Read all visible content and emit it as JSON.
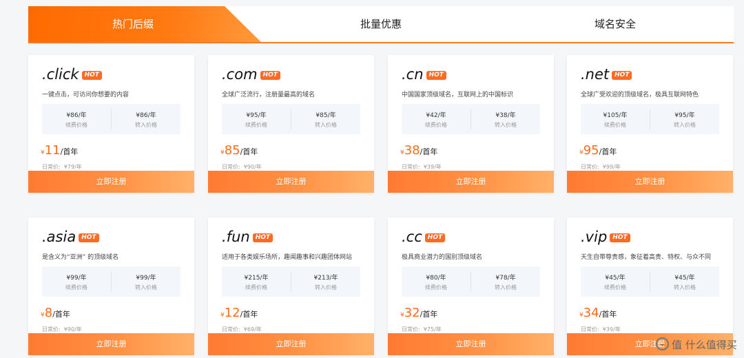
{
  "tabs": [
    {
      "label": "热门后缀",
      "active": true
    },
    {
      "label": "批量优惠",
      "active": false
    },
    {
      "label": "域名安全",
      "active": false
    }
  ],
  "hot_label": "HOT",
  "labels": {
    "renew": "续费价格",
    "transfer": "转入价格",
    "per_first_year": "/首年",
    "regular_prefix": "日常价:",
    "register_button": "立即注册",
    "currency": "¥"
  },
  "cards": [
    {
      "domain": ".click",
      "desc": "一键点击，可访问你想要的内容",
      "renew_price": "¥86/年",
      "transfer_price": "¥86/年",
      "first_year": "11",
      "regular_price": "¥79/年"
    },
    {
      "domain": ".com",
      "desc": "全球广泛流行，注册量最高的域名",
      "renew_price": "¥95/年",
      "transfer_price": "¥85/年",
      "first_year": "85",
      "regular_price": "¥90/年"
    },
    {
      "domain": ".cn",
      "desc": "中国国家顶级域名，互联网上的中国标识",
      "renew_price": "¥42/年",
      "transfer_price": "¥38/年",
      "first_year": "38",
      "regular_price": "¥39/年"
    },
    {
      "domain": ".net",
      "desc": "全球广受欢迎的顶级域名，极具互联网特色",
      "renew_price": "¥105/年",
      "transfer_price": "¥95/年",
      "first_year": "95",
      "regular_price": "¥99/年"
    },
    {
      "domain": ".asia",
      "desc": "是含义为“亚洲” 的顶级域名",
      "renew_price": "¥99/年",
      "transfer_price": "¥99/年",
      "first_year": "8",
      "regular_price": "¥90/年"
    },
    {
      "domain": ".fun",
      "desc": "适用于各类娱乐场所，趣闻趣事和兴趣团体网站",
      "renew_price": "¥215/年",
      "transfer_price": "¥213/年",
      "first_year": "12",
      "regular_price": "¥69/年"
    },
    {
      "domain": ".cc",
      "desc": "极具商业潜力的国别顶级域名",
      "renew_price": "¥80/年",
      "transfer_price": "¥78/年",
      "first_year": "32",
      "regular_price": "¥75/年"
    },
    {
      "domain": ".vip",
      "desc": "天生自带尊贵感，象征着高贵、特权、与众不同",
      "renew_price": "¥45/年",
      "transfer_price": "¥45/年",
      "first_year": "34",
      "regular_price": "¥39/年"
    }
  ],
  "watermark": "值 什么值得买",
  "colors": {
    "accent": "#ff6b1a",
    "button_start": "#ff7a32",
    "button_end": "#ffb169"
  }
}
